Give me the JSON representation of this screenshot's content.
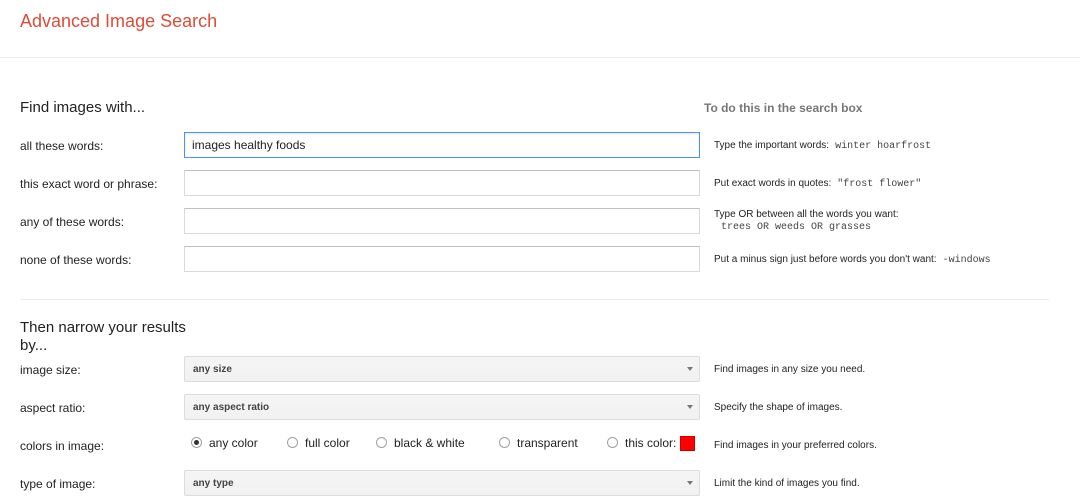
{
  "header": {
    "title": "Advanced Image Search"
  },
  "find": {
    "heading": "Find images with...",
    "hint_heading": "To do this in the search box",
    "rows": [
      {
        "label": "all these words:",
        "value": "images healthy foods",
        "hint": "Type the important words:",
        "example": "winter hoarfrost"
      },
      {
        "label": "this exact word or phrase:",
        "value": "",
        "hint": "Put exact words in quotes:",
        "example": "\"frost flower\""
      },
      {
        "label": "any of these words:",
        "value": "",
        "hint": "Type OR between all the words you want:",
        "example": "trees OR weeds OR grasses"
      },
      {
        "label": "none of these words:",
        "value": "",
        "hint": "Put a minus sign just before words you don't want:",
        "example": "-windows"
      }
    ]
  },
  "narrow": {
    "heading_line1": "Then narrow your results",
    "heading_line2": "by...",
    "image_size": {
      "label": "image size:",
      "selected": "any size",
      "hint": "Find images in any size you need."
    },
    "aspect_ratio": {
      "label": "aspect ratio:",
      "selected": "any aspect ratio",
      "hint": "Specify the shape of images."
    },
    "colors": {
      "label": "colors in image:",
      "options": [
        "any color",
        "full color",
        "black & white",
        "transparent",
        "this color:"
      ],
      "selected": "any color",
      "this_color_swatch": "#ff0000",
      "hint": "Find images in your preferred colors."
    },
    "type_of_image": {
      "label": "type of image:",
      "selected": "any type",
      "hint": "Limit the kind of images you find."
    }
  },
  "colors": {
    "title": "#dd4b39",
    "focus_border": "#4d90fe"
  }
}
